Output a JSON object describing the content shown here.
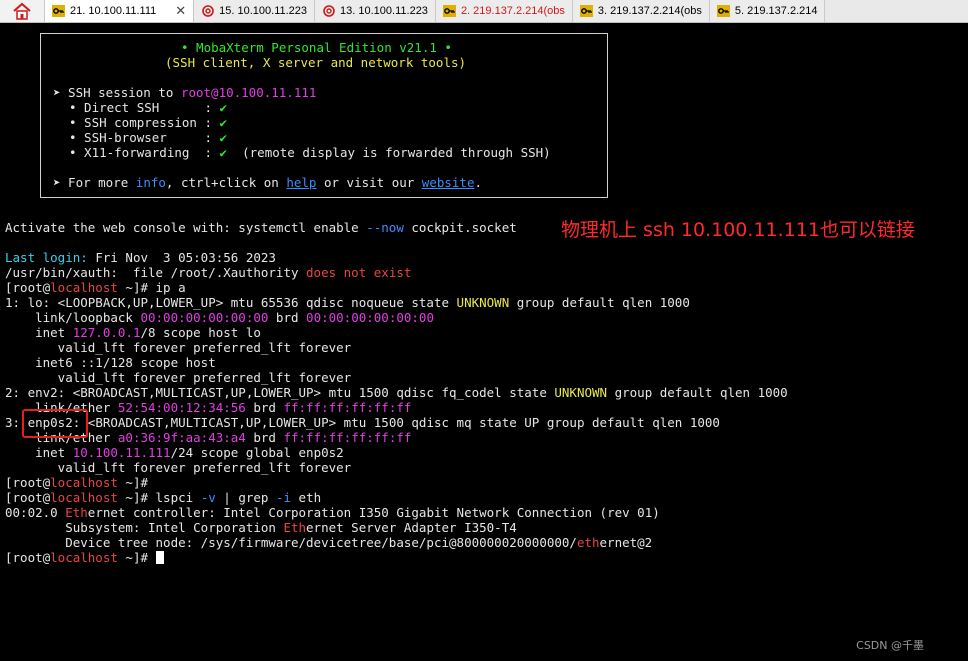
{
  "tabs": [
    {
      "label": "21. 10.100.11.111",
      "active": true,
      "icon": "key-icon"
    },
    {
      "label": "15. 10.100.11.223",
      "icon": "spiral-icon"
    },
    {
      "label": "13. 10.100.11.223",
      "icon": "spiral-icon"
    },
    {
      "label": "2. 219.137.2.214(obs",
      "icon": "key-icon",
      "color": "#d21a1a"
    },
    {
      "label": "3. 219.137.2.214(obs",
      "icon": "key-icon"
    },
    {
      "label": "5. 219.137.2.214",
      "icon": "key-icon"
    }
  ],
  "banner": {
    "title": "• MobaXterm Personal Edition v21.1 •",
    "subtitle": "(SSH client, X server and network tools)",
    "session_prefix": "➤ SSH session to ",
    "session_target": "root@10.100.11.111",
    "features": [
      {
        "name": "• Direct SSH      :",
        "value": "✔",
        "note": ""
      },
      {
        "name": "• SSH compression :",
        "value": "✔",
        "note": ""
      },
      {
        "name": "• SSH-browser     :",
        "value": "✔",
        "note": ""
      },
      {
        "name": "• X11-forwarding  :",
        "value": "✔",
        "note": "(remote display is forwarded through SSH)"
      }
    ],
    "more_prefix": "➤ For more ",
    "more_info": "info",
    "more_mid": ", ctrl+click on ",
    "more_help": "help",
    "more_or": " or visit our ",
    "more_website": "website",
    "more_end": "."
  },
  "terminal": {
    "activate_prefix": "Activate the web console with: systemctl enable ",
    "activate_flag": "--now",
    "activate_suffix": " cockpit.socket",
    "last_login_label": "Last login:",
    "last_login_value": " Fri Nov  3 05:03:56 2023",
    "xauth_prefix": "/usr/bin/xauth:  file /root/.Xauthority ",
    "xauth_suffix": "does not exist",
    "prompt_open": "[root@",
    "prompt_host": "localhost",
    "prompt_close": " ~]# ",
    "cmd1": "ip a",
    "lo1_a": "1: lo: <LOOPBACK,UP,LOWER_UP> mtu 65536 qdisc noqueue state ",
    "unknown": "UNKNOWN",
    "lo1_b": " group default qlen 1000",
    "lo2_a": "    link/loopback ",
    "lo_mac": "00:00:00:00:00:00",
    "lo2_brd": " brd ",
    "lo_brd": "00:00:00:00:00:00",
    "lo3_a": "    inet ",
    "lo_ip": "127.0.0.1",
    "lo3_b": "/8 scope host lo",
    "valid": "       valid_lft forever preferred_lft forever",
    "lo5": "    inet6 ::1/128 scope host",
    "env1_a": "2: env2: <BROADCAST,MULTICAST,UP,LOWER_UP> mtu 1500 qdisc fq_codel state ",
    "env1_b": " group default qlen 1000",
    "env2_a": "    link/ether ",
    "env_mac": "52:54:00:12:34:56",
    "brd": " brd ",
    "bcast": "ff:ff:ff:ff:ff:ff",
    "enp1_num": "3: ",
    "enp1_name": "enp0s2:",
    "enp1_b": " <BROADCAST,MULTICAST,UP,LOWER_UP> mtu 1500 qdisc mq state UP group default qlen 1000",
    "enp_mac": "a0:36:9f:aa:43:a4",
    "enp3_a": "    inet ",
    "enp_ip": "10.100.11.111",
    "enp3_b": "/24 scope global enp0s2",
    "cmd2_a": "lspci ",
    "cmd2_flag1": "-v",
    "cmd2_b": " | grep ",
    "cmd2_flag2": "-i",
    "cmd2_c": " eth",
    "pci1_a": "00:02.0 ",
    "eth_hl": "Eth",
    "pci1_b": "ernet controller: Intel Corporation I350 Gigabit Network Connection (rev 01)",
    "pci2_a": "        Subsystem: Intel Corporation ",
    "pci2_b": "ernet Server Adapter I350-T4",
    "pci3_a": "        Device tree node: /sys/firmware/devicetree/base/pci@800000020000000/",
    "eth_hl2": "eth",
    "pci3_b": "ernet@2"
  },
  "annotation": "物理机上 ssh 10.100.11.111也可以链接",
  "watermark": "CSDN @千墨"
}
